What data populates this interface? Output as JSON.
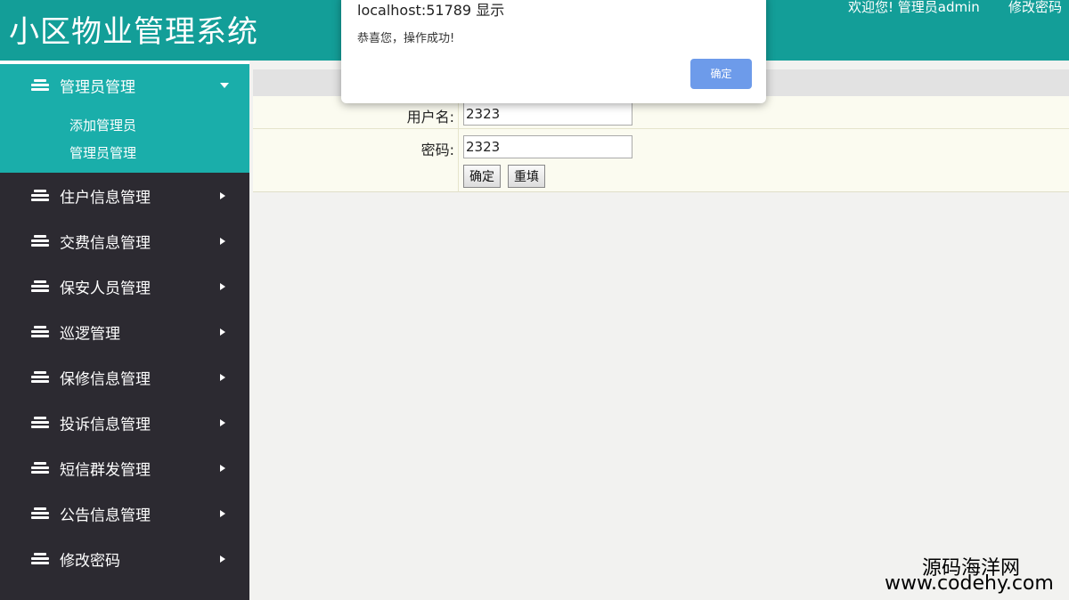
{
  "header": {
    "title": "小区物业管理系统",
    "welcome": "欢迎您! 管理员admin",
    "change_password": "修改密码"
  },
  "sidebar": {
    "active_group": {
      "label": "管理员管理",
      "sub_items": [
        "添加管理员",
        "管理员管理"
      ]
    },
    "items": [
      {
        "label": "住户信息管理"
      },
      {
        "label": "交费信息管理"
      },
      {
        "label": "保安人员管理"
      },
      {
        "label": "巡逻管理"
      },
      {
        "label": "保修信息管理"
      },
      {
        "label": "投诉信息管理"
      },
      {
        "label": "短信群发管理"
      },
      {
        "label": "公告信息管理"
      },
      {
        "label": "修改密码"
      }
    ]
  },
  "form": {
    "username_label": "用户名:",
    "username_value": "2323",
    "password_label": "密码:",
    "password_value": "2323",
    "submit_label": "确定",
    "reset_label": "重填"
  },
  "alert": {
    "title": "localhost:51789 显示",
    "message": "恭喜您，操作成功!",
    "ok_label": "确定"
  },
  "watermark": {
    "line1": "源码海洋网",
    "line2": "www.codehy.com"
  }
}
